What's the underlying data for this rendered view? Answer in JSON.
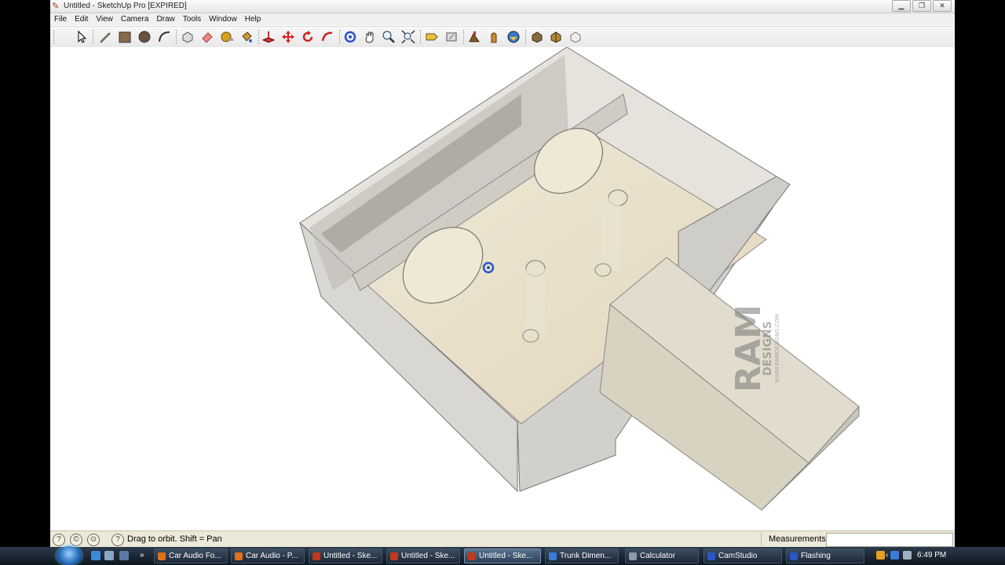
{
  "window": {
    "title": "Untitled - SketchUp Pro [EXPIRED]",
    "buttons": {
      "minimize": "▁",
      "maximize": "❐",
      "close": "✕"
    }
  },
  "menu": [
    "File",
    "Edit",
    "View",
    "Camera",
    "Draw",
    "Tools",
    "Window",
    "Help"
  ],
  "toolbar": {
    "tools": [
      "select-icon",
      "pencil-icon",
      "rectangle-icon",
      "circle-icon",
      "arc-icon",
      "make-component-icon",
      "eraser-icon",
      "tape-measure-icon",
      "paint-bucket-icon",
      "push-pull-icon",
      "move-icon",
      "rotate-icon",
      "follow-me-icon",
      "orbit-icon",
      "pan-icon",
      "zoom-icon",
      "zoom-extents-icon",
      "previous-view-icon",
      "next-view-icon",
      "add-location-icon",
      "toggle-terrain-icon",
      "get-models-icon",
      "share-model-icon",
      "get-components-icon",
      "share-component-icon"
    ]
  },
  "watermark": {
    "main": "RAM",
    "sub": "DESIGNS",
    "url": "WWW.RAMDESIGNS.COM"
  },
  "status": {
    "text": "Drag to orbit.  Shift = Pan",
    "measurements_label": "Measurements",
    "measurements_value": ""
  },
  "taskbar": {
    "items": [
      {
        "label": "Car Audio Fo...",
        "icon_color": "#e0701a"
      },
      {
        "label": "Car Audio - P...",
        "icon_color": "#e0701a"
      },
      {
        "label": "Untitled - Ske...",
        "icon_color": "#c0391b"
      },
      {
        "label": "Untitled - Ske...",
        "icon_color": "#c0391b"
      },
      {
        "label": "Untitled - Ske...",
        "icon_color": "#c0391b"
      },
      {
        "label": "Trunk Dimen...",
        "icon_color": "#3a7bd5"
      },
      {
        "label": "Calculator",
        "icon_color": "#8a9aa8"
      },
      {
        "label": "CamStudio",
        "icon_color": "#2a56c6"
      },
      {
        "label": "Flashing",
        "icon_color": "#2a56c6"
      }
    ],
    "active_index": 4,
    "clock": "6:49 PM"
  }
}
